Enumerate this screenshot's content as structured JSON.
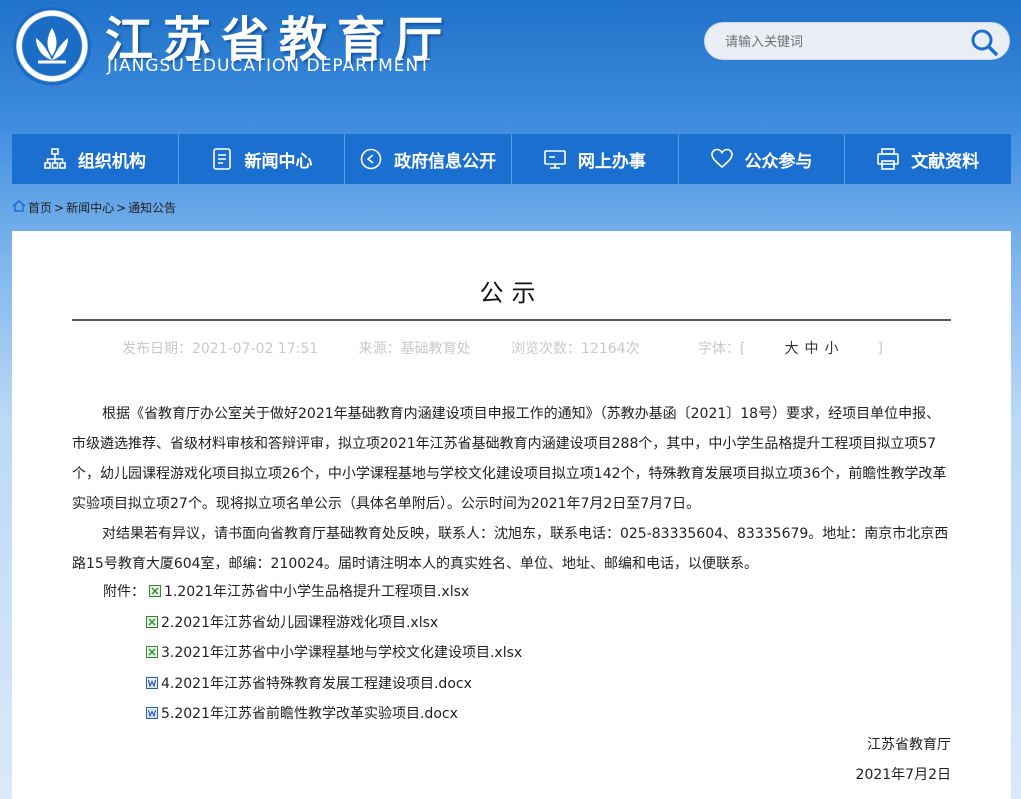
{
  "header": {
    "title": "江苏省教育厅",
    "subtitle": "JIANGSU EDUCATION DEPARTMENT",
    "logo_icon": "lotus-emblem-icon"
  },
  "search": {
    "placeholder": "请输入关键词",
    "icon": "search-icon"
  },
  "nav": {
    "items": [
      {
        "label": "组织机构",
        "icon": "org-chart-icon"
      },
      {
        "label": "新闻中心",
        "icon": "document-icon"
      },
      {
        "label": "政府信息公开",
        "icon": "sound-icon"
      },
      {
        "label": "网上办事",
        "icon": "monitor-icon"
      },
      {
        "label": "公众参与",
        "icon": "heart-icon"
      },
      {
        "label": "文献资料",
        "icon": "printer-icon"
      }
    ]
  },
  "breadcrumb": {
    "home": "首页",
    "section": "新闻中心",
    "current": "通知公告",
    "sep": ">"
  },
  "article": {
    "title": "公示",
    "date_label": "发布日期：2021-07-02 17:51",
    "source_label": "来源：基础教育处",
    "views_label": "浏览次数：12164次",
    "fontsize_label": "字体：[",
    "fontsize_large": "大",
    "fontsize_medium": "中",
    "fontsize_small": "小",
    "fontsize_close": "]",
    "paragraph1": "根据《省教育厅办公室关于做好2021年基础教育内涵建设项目申报工作的通知》（苏教办基函〔2021〕18号）要求，经项目单位申报、市级遴选推荐、省级材料审核和答辩评审，拟立项2021年江苏省基础教育内涵建设项目288个，其中，中小学生品格提升工程项目拟立项57个，幼儿园课程游戏化项目拟立项26个，中小学课程基地与学校文化建设项目拟立项142个，特殊教育发展项目拟立项36个，前瞻性教学改革实验项目拟立项27个。现将拟立项名单公示（具体名单附后）。公示时间为2021年7月2日至7月7日。",
    "paragraph2": "对结果若有异议，请书面向省教育厅基础教育处反映，联系人：沈旭东，联系电话：025-83335604、83335679。地址：南京市北京西路15号教育大厦604室，邮编：210024。届时请注明本人的真实姓名、单位、地址、邮编和电话，以便联系。",
    "attachments_label": "附件：",
    "attachments": [
      {
        "name": "1.2021年江苏省中小学生品格提升工程项目.xlsx",
        "icon": "excel-file-icon"
      },
      {
        "name": "2.2021年江苏省幼儿园课程游戏化项目.xlsx",
        "icon": "excel-file-icon"
      },
      {
        "name": "3.2021年江苏省中小学课程基地与学校文化建设项目.xlsx",
        "icon": "excel-file-icon"
      },
      {
        "name": "4.2021年江苏省特殊教育发展工程建设项目.docx",
        "icon": "word-file-icon"
      },
      {
        "name": "5.2021年江苏省前瞻性教学改革实验项目.docx",
        "icon": "word-file-icon"
      }
    ],
    "signature_org": "江苏省教育厅",
    "signature_date": "2021年7月2日"
  },
  "colors": {
    "nav_bg": "#1a6fd0",
    "header_bg": "#1f73c8",
    "meta_text": "#c9c9c9"
  }
}
